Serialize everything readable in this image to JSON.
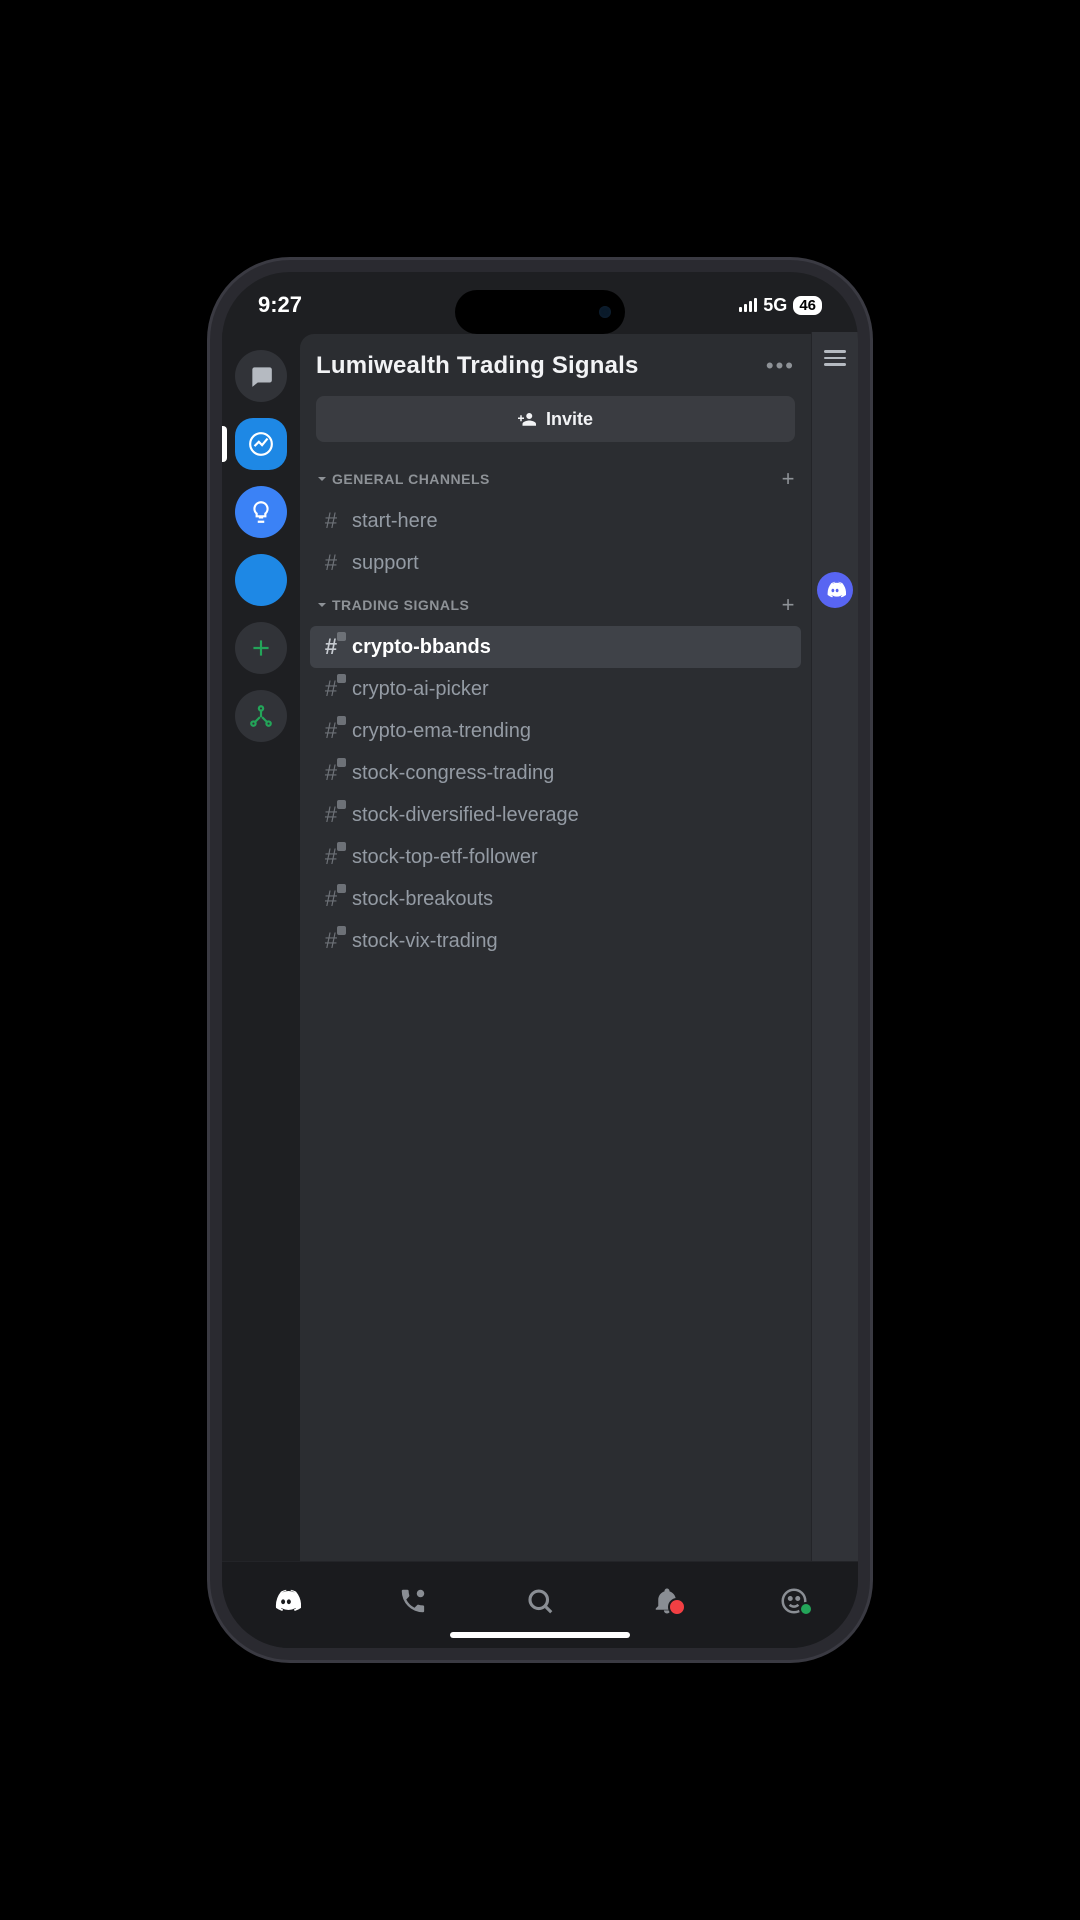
{
  "status": {
    "time": "9:27",
    "network": "5G",
    "battery": "46"
  },
  "server": {
    "title": "Lumiwealth Trading Signals",
    "invite_label": "Invite"
  },
  "rail": {
    "items": [
      {
        "name": "dm-home",
        "icon": "chat",
        "style": "default"
      },
      {
        "name": "server-lumiwealth-signals",
        "icon": "chart",
        "style": "selected"
      },
      {
        "name": "server-lumiwealth-ideas",
        "icon": "bulb",
        "style": "blue"
      },
      {
        "name": "server-blank",
        "icon": "",
        "style": "solid"
      },
      {
        "name": "add-server",
        "icon": "plus",
        "style": "add"
      },
      {
        "name": "discover",
        "icon": "hub",
        "style": "discover"
      }
    ]
  },
  "categories": [
    {
      "name": "GENERAL CHANNELS",
      "channels": [
        {
          "name": "start-here",
          "locked": false,
          "active": false
        },
        {
          "name": "support",
          "locked": false,
          "active": false
        }
      ]
    },
    {
      "name": "TRADING SIGNALS",
      "channels": [
        {
          "name": "crypto-bbands",
          "locked": true,
          "active": true
        },
        {
          "name": "crypto-ai-picker",
          "locked": true,
          "active": false
        },
        {
          "name": "crypto-ema-trending",
          "locked": true,
          "active": false
        },
        {
          "name": "stock-congress-trading",
          "locked": true,
          "active": false
        },
        {
          "name": "stock-diversified-leverage",
          "locked": true,
          "active": false
        },
        {
          "name": "stock-top-etf-follower",
          "locked": true,
          "active": false
        },
        {
          "name": "stock-breakouts",
          "locked": true,
          "active": false
        },
        {
          "name": "stock-vix-trading",
          "locked": true,
          "active": false
        }
      ]
    }
  ],
  "tabs": [
    {
      "name": "tab-servers",
      "icon": "discord",
      "active": true,
      "badge": ""
    },
    {
      "name": "tab-calls",
      "icon": "phone",
      "active": false,
      "badge": ""
    },
    {
      "name": "tab-search",
      "icon": "search",
      "active": false,
      "badge": ""
    },
    {
      "name": "tab-notifications",
      "icon": "bell",
      "active": false,
      "badge": "red"
    },
    {
      "name": "tab-you",
      "icon": "face",
      "active": false,
      "badge": "green"
    }
  ]
}
